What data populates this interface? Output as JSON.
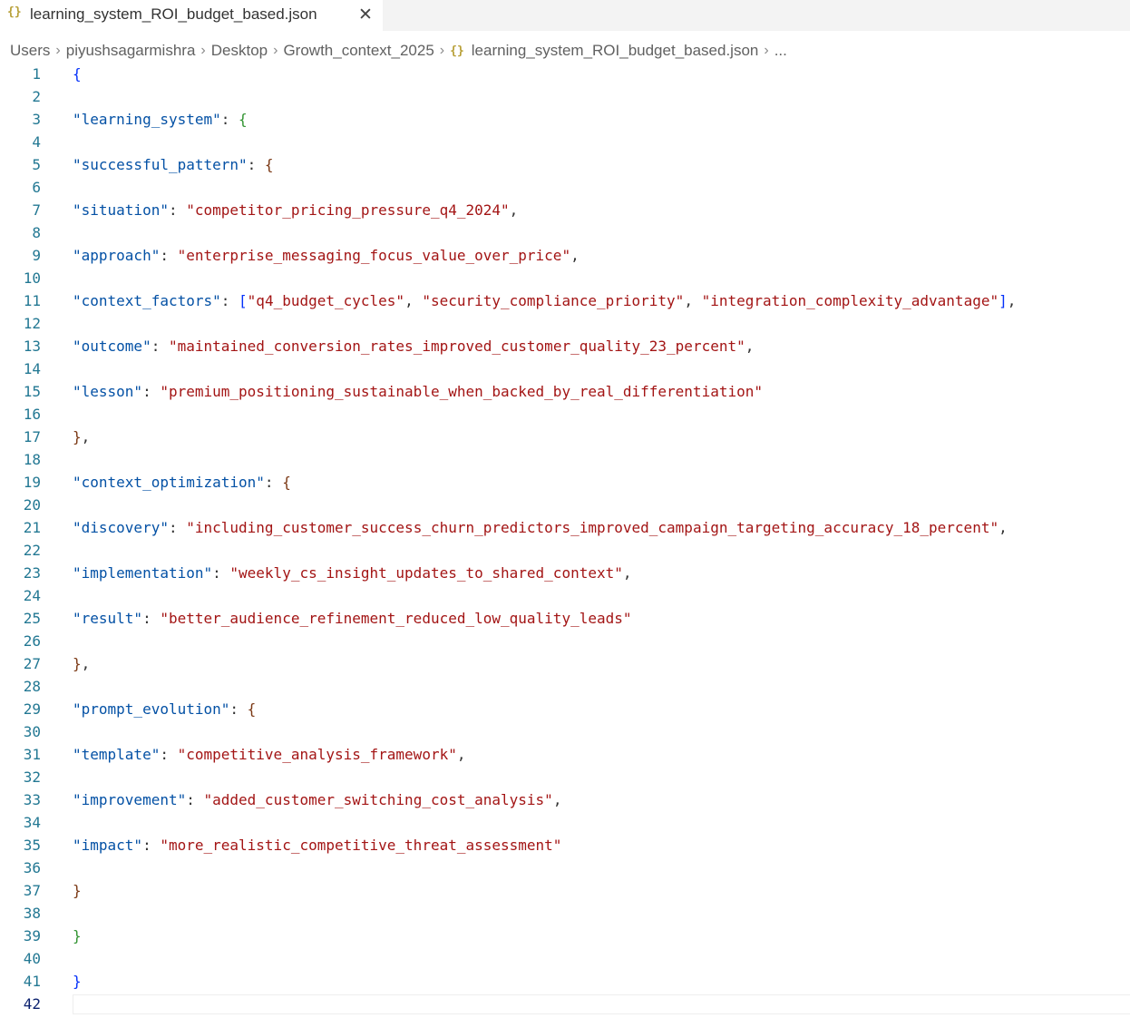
{
  "tab": {
    "icon": "json-file-icon",
    "icon_glyph": "{}",
    "title": "learning_system_ROI_budget_based.json",
    "close_glyph": "✕"
  },
  "breadcrumb": {
    "items": [
      "Users",
      "piyushsagarmishra",
      "Desktop",
      "Growth_context_2025"
    ],
    "file_icon_glyph": "{}",
    "file": "learning_system_ROI_budget_based.json",
    "more": "...",
    "separator": "›"
  },
  "editor": {
    "active_line": 42,
    "lines": [
      [
        [
          "b1",
          "{"
        ]
      ],
      [],
      [
        [
          "k",
          "\"learning_system\""
        ],
        [
          "p",
          ": "
        ],
        [
          "b2",
          "{"
        ]
      ],
      [],
      [
        [
          "k",
          "\"successful_pattern\""
        ],
        [
          "p",
          ": "
        ],
        [
          "b3",
          "{"
        ]
      ],
      [],
      [
        [
          "k",
          "\"situation\""
        ],
        [
          "p",
          ": "
        ],
        [
          "s",
          "\"competitor_pricing_pressure_q4_2024\""
        ],
        [
          "p",
          ","
        ]
      ],
      [],
      [
        [
          "k",
          "\"approach\""
        ],
        [
          "p",
          ": "
        ],
        [
          "s",
          "\"enterprise_messaging_focus_value_over_price\""
        ],
        [
          "p",
          ","
        ]
      ],
      [],
      [
        [
          "k",
          "\"context_factors\""
        ],
        [
          "p",
          ": "
        ],
        [
          "b1",
          "["
        ],
        [
          "s",
          "\"q4_budget_cycles\""
        ],
        [
          "p",
          ", "
        ],
        [
          "s",
          "\"security_compliance_priority\""
        ],
        [
          "p",
          ", "
        ],
        [
          "s",
          "\"integration_complexity_advantage\""
        ],
        [
          "b1",
          "]"
        ],
        [
          "p",
          ","
        ]
      ],
      [],
      [
        [
          "k",
          "\"outcome\""
        ],
        [
          "p",
          ": "
        ],
        [
          "s",
          "\"maintained_conversion_rates_improved_customer_quality_23_percent\""
        ],
        [
          "p",
          ","
        ]
      ],
      [],
      [
        [
          "k",
          "\"lesson\""
        ],
        [
          "p",
          ": "
        ],
        [
          "s",
          "\"premium_positioning_sustainable_when_backed_by_real_differentiation\""
        ]
      ],
      [],
      [
        [
          "b3",
          "}"
        ],
        [
          "p",
          ","
        ]
      ],
      [],
      [
        [
          "k",
          "\"context_optimization\""
        ],
        [
          "p",
          ": "
        ],
        [
          "b3",
          "{"
        ]
      ],
      [],
      [
        [
          "k",
          "\"discovery\""
        ],
        [
          "p",
          ": "
        ],
        [
          "s",
          "\"including_customer_success_churn_predictors_improved_campaign_targeting_accuracy_18_percent\""
        ],
        [
          "p",
          ","
        ]
      ],
      [],
      [
        [
          "k",
          "\"implementation\""
        ],
        [
          "p",
          ": "
        ],
        [
          "s",
          "\"weekly_cs_insight_updates_to_shared_context\""
        ],
        [
          "p",
          ","
        ]
      ],
      [],
      [
        [
          "k",
          "\"result\""
        ],
        [
          "p",
          ": "
        ],
        [
          "s",
          "\"better_audience_refinement_reduced_low_quality_leads\""
        ]
      ],
      [],
      [
        [
          "b3",
          "}"
        ],
        [
          "p",
          ","
        ]
      ],
      [],
      [
        [
          "k",
          "\"prompt_evolution\""
        ],
        [
          "p",
          ": "
        ],
        [
          "b3",
          "{"
        ]
      ],
      [],
      [
        [
          "k",
          "\"template\""
        ],
        [
          "p",
          ": "
        ],
        [
          "s",
          "\"competitive_analysis_framework\""
        ],
        [
          "p",
          ","
        ]
      ],
      [],
      [
        [
          "k",
          "\"improvement\""
        ],
        [
          "p",
          ": "
        ],
        [
          "s",
          "\"added_customer_switching_cost_analysis\""
        ],
        [
          "p",
          ","
        ]
      ],
      [],
      [
        [
          "k",
          "\"impact\""
        ],
        [
          "p",
          ": "
        ],
        [
          "s",
          "\"more_realistic_competitive_threat_assessment\""
        ]
      ],
      [],
      [
        [
          "b3",
          "}"
        ]
      ],
      [],
      [
        [
          "b2",
          "}"
        ]
      ],
      [],
      [
        [
          "b1",
          "}"
        ]
      ],
      []
    ]
  }
}
